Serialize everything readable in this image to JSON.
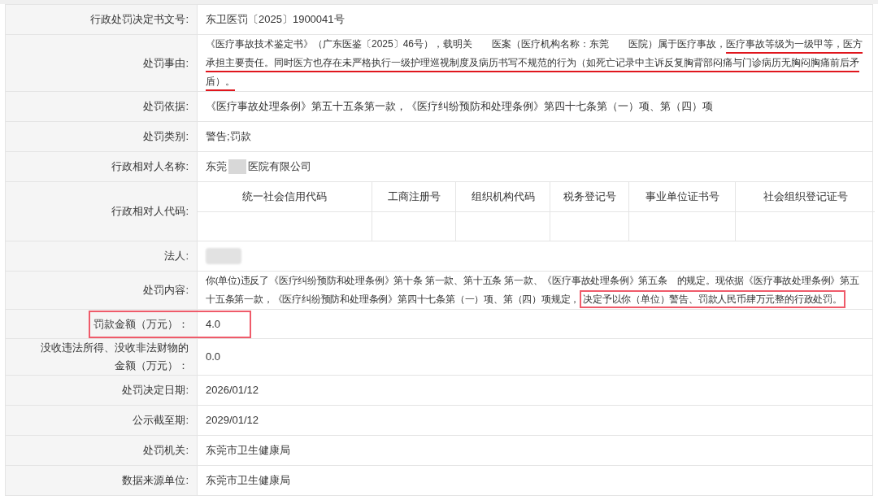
{
  "rows": [
    {
      "kind": "text",
      "label": "行政处罚决定书文号:",
      "value": "东卫医罚〔2025〕1900041号"
    },
    {
      "kind": "segments",
      "label": "处罚事由:",
      "segments": [
        {
          "text": "《医疗事故技术鉴定书》（广东医鉴〔2025〕46号），载明关　　医案（医疗机构名称：东莞　　医院）属于医疗事故，",
          "kind": "plain"
        },
        {
          "text": "医疗事故等级为一级甲等，医方承担主要责任。同时医方也存在未严格执行一级护理巡视制度及病历书写不规范的行为（如死亡记录中主诉反复胸背部闷痛与门诊病历无胸闷胸痛前后矛盾）。",
          "kind": "underline"
        }
      ]
    },
    {
      "kind": "text",
      "label": "处罚依据:",
      "value": "《医疗事故处理条例》第五十五条第一款，《医疗纠纷预防和处理条例》第四十七条第（一）项、第（四）项"
    },
    {
      "kind": "text",
      "label": "处罚类别:",
      "value": "警告;罚款"
    },
    {
      "kind": "redacted",
      "label": "行政相对人名称:",
      "parts": [
        "东莞",
        "医院有限公司"
      ]
    },
    {
      "kind": "codes",
      "label": "行政相对人代码:",
      "columns": [
        "统一社会信用代码",
        "工商注册号",
        "组织机构代码",
        "税务登记号",
        "事业单位证书号",
        "社会组织登记证号"
      ]
    },
    {
      "kind": "blurred",
      "label": "法人:"
    },
    {
      "kind": "segments",
      "label": "处罚内容:",
      "segments": [
        {
          "text": "你(单位)违反了《医疗纠纷预防和处理条例》第十条 第一款、第十五条 第一款、《医疗事故处理条例》第五条　的规定。现依据《医疗事故处理条例》第五十五条第一款，《医疗纠纷预防和处理条例》第四十七条第（一）项、第（四）项规定，",
          "kind": "plain"
        },
        {
          "text": "决定予以你（单位）警告、罚款人民币肆万元整的行政处罚。",
          "kind": "box"
        }
      ]
    },
    {
      "kind": "text",
      "label": "罚款金额（万元）：",
      "value": "4.0",
      "highlighted": true
    },
    {
      "kind": "text",
      "label": "没收违法所得、没收非法财物的金额（万元）：",
      "value": "0.0"
    },
    {
      "kind": "text",
      "label": "处罚决定日期:",
      "value": "2026/01/12"
    },
    {
      "kind": "text",
      "label": "公示截至期:",
      "value": "2029/01/12"
    },
    {
      "kind": "text",
      "label": "处罚机关:",
      "value": "东莞市卫生健康局"
    },
    {
      "kind": "text",
      "label": "数据来源单位:",
      "value": "东莞市卫生健康局"
    }
  ]
}
